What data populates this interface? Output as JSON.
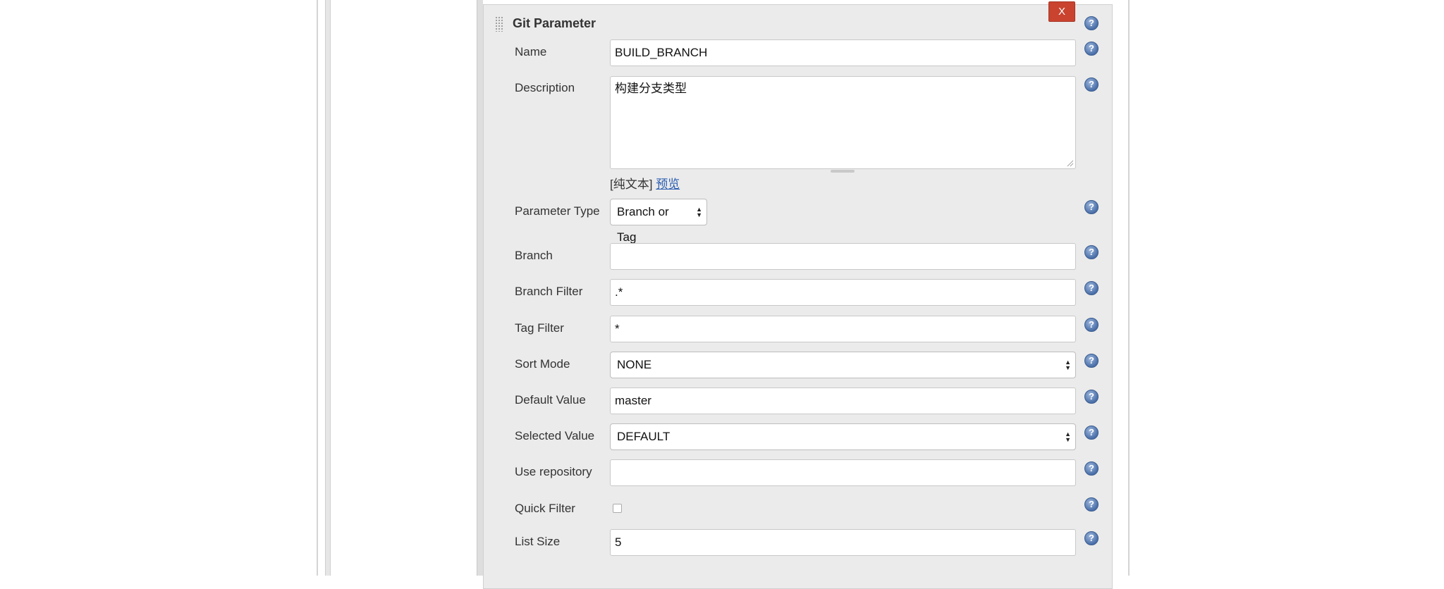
{
  "panel": {
    "title": "Git Parameter",
    "close_label": "X"
  },
  "fields": {
    "name": {
      "label": "Name",
      "value": "BUILD_BRANCH"
    },
    "description": {
      "label": "Description",
      "value": "构建分支类型"
    },
    "markup": {
      "plain_text": "[纯文本]",
      "preview_link": "预览"
    },
    "parameter_type": {
      "label": "Parameter Type",
      "value": "Branch or Tag"
    },
    "branch": {
      "label": "Branch",
      "value": ""
    },
    "branch_filter": {
      "label": "Branch Filter",
      "value": ".*"
    },
    "tag_filter": {
      "label": "Tag Filter",
      "value": "*"
    },
    "sort_mode": {
      "label": "Sort Mode",
      "value": "NONE"
    },
    "default_value": {
      "label": "Default Value",
      "value": "master"
    },
    "selected_value": {
      "label": "Selected Value",
      "value": "DEFAULT"
    },
    "use_repository": {
      "label": "Use repository",
      "value": ""
    },
    "quick_filter": {
      "label": "Quick Filter",
      "checked": false
    },
    "list_size": {
      "label": "List Size",
      "value": "5"
    }
  },
  "help_icon": {
    "glyph": "?"
  },
  "colors": {
    "close_button": "#c9432f",
    "panel_background": "#ebebeb",
    "link": "#2a5db0",
    "help_icon": "#4a6fa8"
  }
}
